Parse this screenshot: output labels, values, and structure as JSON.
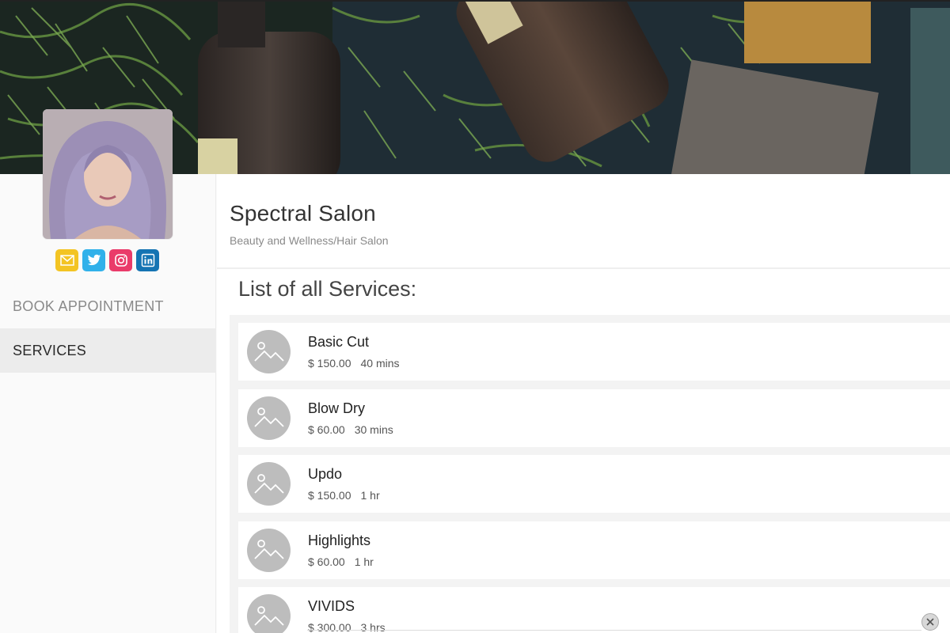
{
  "business": {
    "name": "Spectral Salon",
    "category": "Beauty and Wellness/Hair Salon"
  },
  "social_icons": [
    "envelope-icon",
    "twitter-icon",
    "instagram-icon",
    "linkedin-icon"
  ],
  "nav": {
    "items": [
      {
        "label": "BOOK APPOINTMENT",
        "active": false
      },
      {
        "label": "SERVICES",
        "active": true
      }
    ]
  },
  "services": {
    "title": "List of all Services:",
    "items": [
      {
        "name": "Basic Cut",
        "price": "$ 150.00",
        "duration": "40 mins"
      },
      {
        "name": "Blow Dry",
        "price": "$ 60.00",
        "duration": "30 mins"
      },
      {
        "name": "Updo",
        "price": "$ 150.00",
        "duration": "1 hr"
      },
      {
        "name": "Highlights",
        "price": "$ 60.00",
        "duration": "1 hr"
      },
      {
        "name": "VIVIDS",
        "price": "$ 300.00",
        "duration": "3 hrs"
      }
    ]
  },
  "colors": {
    "email": "#f3c423",
    "twitter": "#31b1ea",
    "instagram": "#ea3b6a",
    "linkedin": "#1574b3",
    "active_nav_bg": "#ececec"
  }
}
